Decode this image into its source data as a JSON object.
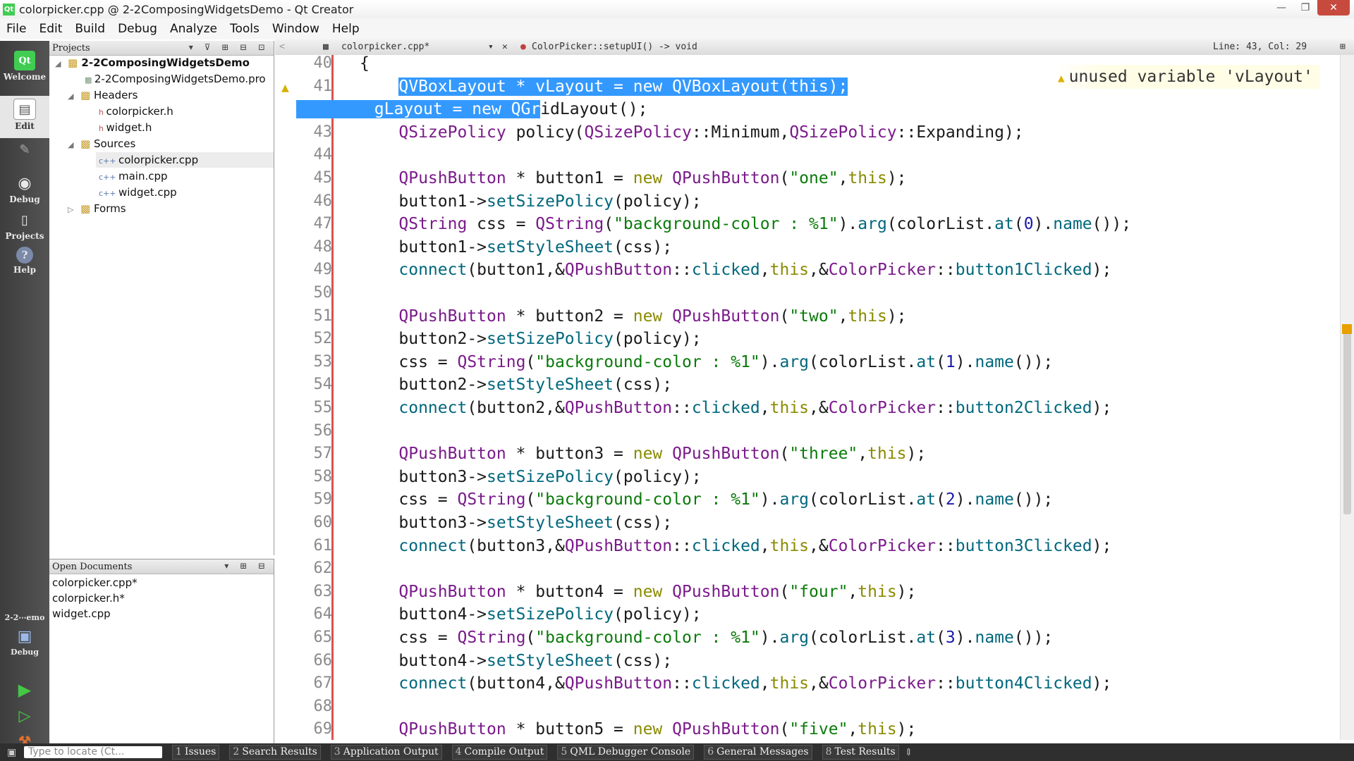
{
  "window": {
    "title": "colorpicker.cpp @ 2-2ComposingWidgetsDemo - Qt Creator",
    "app_icon": "Qt",
    "controls": [
      "—",
      "❐",
      "✕"
    ]
  },
  "menu": [
    "File",
    "Edit",
    "Build",
    "Debug",
    "Analyze",
    "Tools",
    "Window",
    "Help"
  ],
  "modes": [
    {
      "label": "Welcome",
      "icon": "qt-logo-icon"
    },
    {
      "label": "Edit",
      "icon": "edit-document-icon"
    },
    {
      "label": "Design",
      "icon": "design-pen-icon"
    },
    {
      "label": "Debug",
      "icon": "debug-bug-icon"
    },
    {
      "label": "Projects",
      "icon": "projects-wrench-icon"
    },
    {
      "label": "Help",
      "icon": "help-question-icon"
    }
  ],
  "target_selector": {
    "project": "2-2⋯emo",
    "mode": "Debug"
  },
  "run_buttons": [
    "run-icon",
    "debug-run-icon",
    "build-hammer-icon"
  ],
  "projects_panel": {
    "title": "Projects",
    "items": [
      {
        "label": "2-2ComposingWidgetsDemo",
        "level": 0,
        "bold": true,
        "toggle": "◢"
      },
      {
        "label": "2-2ComposingWidgetsDemo.pro",
        "level": 1
      },
      {
        "label": "Headers",
        "level": 1,
        "toggle": "◢"
      },
      {
        "label": "colorpicker.h",
        "level": 2
      },
      {
        "label": "widget.h",
        "level": 2
      },
      {
        "label": "Sources",
        "level": 1,
        "toggle": "◢"
      },
      {
        "label": "colorpicker.cpp",
        "level": 2,
        "selected": true
      },
      {
        "label": "main.cpp",
        "level": 2
      },
      {
        "label": "widget.cpp",
        "level": 2
      },
      {
        "label": "Forms",
        "level": 1,
        "toggle": "▷"
      }
    ]
  },
  "open_documents": {
    "title": "Open Documents",
    "items": [
      "colorpicker.cpp*",
      "colorpicker.h*",
      "widget.cpp"
    ]
  },
  "editor_header": {
    "file": "colorpicker.cpp*",
    "symbol": "ColorPicker::setupUI() -> void",
    "position": "Line: 43, Col: 29"
  },
  "warning": "unused variable 'vLayout'",
  "code_lines": [
    {
      "n": "40",
      "text": "{"
    },
    {
      "n": "41",
      "text": "    QVBoxLayout * vLayout = new QVBoxLayout(this);"
    },
    {
      "n": "42",
      "text": "    gLayout = new QGridLayout();"
    },
    {
      "n": "43",
      "text": "    QSizePolicy policy(QSizePolicy::Minimum,QSizePolicy::Expanding);"
    },
    {
      "n": "44",
      "text": ""
    },
    {
      "n": "45",
      "text": "    QPushButton * button1 = new QPushButton(\"one\",this);"
    },
    {
      "n": "46",
      "text": "    button1->setSizePolicy(policy);"
    },
    {
      "n": "47",
      "text": "    QString css = QString(\"background-color : %1\").arg(colorList.at(0).name());"
    },
    {
      "n": "48",
      "text": "    button1->setStyleSheet(css);"
    },
    {
      "n": "49",
      "text": "    connect(button1,&QPushButton::clicked,this,&ColorPicker::button1Clicked);"
    },
    {
      "n": "50",
      "text": ""
    },
    {
      "n": "51",
      "text": "    QPushButton * button2 = new QPushButton(\"two\",this);"
    },
    {
      "n": "52",
      "text": "    button2->setSizePolicy(policy);"
    },
    {
      "n": "53",
      "text": "    css = QString(\"background-color : %1\").arg(colorList.at(1).name());"
    },
    {
      "n": "54",
      "text": "    button2->setStyleSheet(css);"
    },
    {
      "n": "55",
      "text": "    connect(button2,&QPushButton::clicked,this,&ColorPicker::button2Clicked);"
    },
    {
      "n": "56",
      "text": ""
    },
    {
      "n": "57",
      "text": "    QPushButton * button3 = new QPushButton(\"three\",this);"
    },
    {
      "n": "58",
      "text": "    button3->setSizePolicy(policy);"
    },
    {
      "n": "59",
      "text": "    css = QString(\"background-color : %1\").arg(colorList.at(2).name());"
    },
    {
      "n": "60",
      "text": "    button3->setStyleSheet(css);"
    },
    {
      "n": "61",
      "text": "    connect(button3,&QPushButton::clicked,this,&ColorPicker::button3Clicked);"
    },
    {
      "n": "62",
      "text": ""
    },
    {
      "n": "63",
      "text": "    QPushButton * button4 = new QPushButton(\"four\",this);"
    },
    {
      "n": "64",
      "text": "    button4->setSizePolicy(policy);"
    },
    {
      "n": "65",
      "text": "    css = QString(\"background-color : %1\").arg(colorList.at(3).name());"
    },
    {
      "n": "66",
      "text": "    button4->setStyleSheet(css);"
    },
    {
      "n": "67",
      "text": "    connect(button4,&QPushButton::clicked,this,&ColorPicker::button4Clicked);"
    },
    {
      "n": "68",
      "text": ""
    },
    {
      "n": "69",
      "text": "    QPushButton * button5 = new QPushButton(\"five\",this);"
    }
  ],
  "status_bar": {
    "locate_placeholder": "Type to locate (Ct...",
    "tabs": [
      {
        "n": "1",
        "label": "Issues"
      },
      {
        "n": "2",
        "label": "Search Results"
      },
      {
        "n": "3",
        "label": "Application Output"
      },
      {
        "n": "4",
        "label": "Compile Output"
      },
      {
        "n": "5",
        "label": "QML Debugger Console"
      },
      {
        "n": "6",
        "label": "General Messages"
      },
      {
        "n": "8",
        "label": "Test Results"
      }
    ]
  },
  "colors": {
    "selection": "#3399ff",
    "keyword": "#8a8a00",
    "type": "#7a1a8a",
    "function": "#00677c",
    "string": "#0a7a0a",
    "sidebar_bg": "#4a4a4a",
    "warning": "#e0b000"
  }
}
